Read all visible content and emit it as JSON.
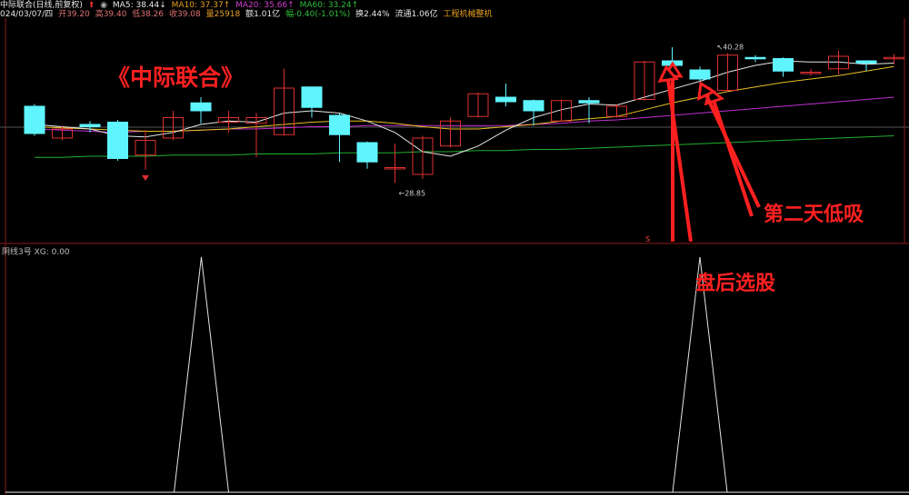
{
  "header": {
    "stock": "中际联合(日线,前复权)",
    "ma5": "MA5: 38.44↓",
    "ma10": "MA10: 37.37↑",
    "ma20": "MA20: 35.66↑",
    "ma60": "MA60: 33.24↑",
    "date": "024/03/07/四",
    "open": "开39.20",
    "high": "高39.40",
    "low": "低38.26",
    "close": "收39.08",
    "volume": "量25918",
    "amount": "额1.01亿",
    "change": "幅-0.40(-1.01%)",
    "turnover": "换2.44%",
    "float": "流通1.06亿",
    "sector": "工程机械整机"
  },
  "title": "《中际联合》",
  "annotations": {
    "low_buy": "第二天低吸",
    "after_close": "盘后选股"
  },
  "price_labels": {
    "high": "40.28",
    "low": "28.85"
  },
  "marker": "S",
  "indicator": {
    "label": "阴线3号  XG: 0.00"
  },
  "colors": {
    "up": "#e03030",
    "down": "#5ff5ff",
    "ma5": "#e6e6e6",
    "ma10": "#e8c020",
    "ma20": "#c030d0",
    "ma60": "#20b030",
    "annotation": "#ff2020"
  },
  "candles": [
    {
      "o": 35.6,
      "c": 33.2,
      "h": 35.8,
      "l": 33.0
    },
    {
      "o": 32.8,
      "c": 33.6,
      "h": 33.9,
      "l": 32.6
    },
    {
      "o": 34.0,
      "c": 33.8,
      "h": 34.3,
      "l": 33.3
    },
    {
      "o": 34.2,
      "c": 31.0,
      "h": 34.4,
      "l": 30.8
    },
    {
      "o": 31.3,
      "c": 32.6,
      "h": 33.5,
      "l": 30.0
    },
    {
      "o": 32.8,
      "c": 34.6,
      "h": 35.2,
      "l": 32.6
    },
    {
      "o": 35.9,
      "c": 35.2,
      "h": 36.4,
      "l": 34.1
    },
    {
      "o": 34.2,
      "c": 34.6,
      "h": 35.2,
      "l": 33.3
    },
    {
      "o": 34.1,
      "c": 34.6,
      "h": 35.0,
      "l": 31.1
    },
    {
      "o": 33.1,
      "c": 37.2,
      "h": 38.9,
      "l": 33.0
    },
    {
      "o": 37.3,
      "c": 35.5,
      "h": 37.3,
      "l": 34.6
    },
    {
      "o": 34.8,
      "c": 33.1,
      "h": 35.0,
      "l": 30.7
    },
    {
      "o": 32.4,
      "c": 30.7,
      "h": 32.5,
      "l": 30.1
    },
    {
      "o": 30.1,
      "c": 30.2,
      "h": 32.3,
      "l": 28.85
    },
    {
      "o": 29.6,
      "c": 32.8,
      "h": 33.0,
      "l": 29.2
    },
    {
      "o": 32.1,
      "c": 34.3,
      "h": 34.6,
      "l": 32.0
    },
    {
      "o": 34.7,
      "c": 36.7,
      "h": 36.8,
      "l": 34.6
    },
    {
      "o": 36.4,
      "c": 36.0,
      "h": 37.6,
      "l": 35.6
    },
    {
      "o": 36.1,
      "c": 35.2,
      "h": 36.2,
      "l": 33.9
    },
    {
      "o": 34.3,
      "c": 36.1,
      "h": 36.2,
      "l": 34.3
    },
    {
      "o": 36.1,
      "c": 35.9,
      "h": 36.4,
      "l": 34.1
    },
    {
      "o": 34.7,
      "c": 35.6,
      "h": 35.8,
      "l": 34.6
    },
    {
      "o": 36.2,
      "c": 39.5,
      "h": 39.6,
      "l": 36.1
    },
    {
      "o": 39.6,
      "c": 39.2,
      "h": 40.8,
      "l": 38.2
    },
    {
      "o": 38.8,
      "c": 38.0,
      "h": 39.1,
      "l": 37.8
    },
    {
      "o": 37.0,
      "c": 40.1,
      "h": 40.28,
      "l": 36.9
    },
    {
      "o": 39.9,
      "c": 39.8,
      "h": 40.1,
      "l": 39.5
    },
    {
      "o": 39.8,
      "c": 38.7,
      "h": 39.9,
      "l": 38.2
    },
    {
      "o": 38.5,
      "c": 38.6,
      "h": 38.9,
      "l": 38.3
    },
    {
      "o": 38.9,
      "c": 40.0,
      "h": 40.5,
      "l": 38.4
    },
    {
      "o": 39.6,
      "c": 39.4,
      "h": 39.6,
      "l": 38.7
    },
    {
      "o": 39.8,
      "c": 39.9,
      "h": 40.2,
      "l": 39.3
    }
  ],
  "ma5_values": [
    34.0,
    33.8,
    33.6,
    33.0,
    32.9,
    33.3,
    34.0,
    34.3,
    34.2,
    35.0,
    35.2,
    35.0,
    34.3,
    33.3,
    31.6,
    31.2,
    32.1,
    33.5,
    34.6,
    35.3,
    35.8,
    35.7,
    36.4,
    37.1,
    37.8,
    38.6,
    39.2,
    39.6,
    39.5,
    39.5,
    39.3,
    39.4
  ],
  "ma10_values": [
    33.8,
    33.7,
    33.6,
    33.5,
    33.4,
    33.4,
    33.5,
    33.6,
    33.8,
    34.0,
    34.2,
    34.3,
    34.3,
    34.1,
    33.8,
    33.6,
    33.6,
    33.8,
    34.0,
    34.3,
    34.5,
    34.7,
    35.3,
    35.9,
    36.4,
    36.9,
    37.3,
    37.7,
    38.0,
    38.3,
    38.7,
    39.1
  ],
  "ma20_values": [
    33.6,
    33.5,
    33.4,
    33.3,
    33.4,
    33.4,
    33.5,
    33.6,
    33.6,
    33.7,
    33.8,
    33.8,
    33.9,
    33.9,
    33.9,
    33.9,
    33.9,
    33.9,
    34.0,
    34.1,
    34.3,
    34.4,
    34.6,
    34.8,
    35.0,
    35.2,
    35.4,
    35.6,
    35.8,
    36.0,
    36.2,
    36.4
  ],
  "ma60_values": [
    31.1,
    31.1,
    31.2,
    31.2,
    31.2,
    31.3,
    31.3,
    31.3,
    31.4,
    31.4,
    31.4,
    31.5,
    31.5,
    31.5,
    31.6,
    31.6,
    31.7,
    31.7,
    31.8,
    31.8,
    31.9,
    32.0,
    32.1,
    32.2,
    32.3,
    32.4,
    32.5,
    32.6,
    32.7,
    32.8,
    32.9,
    33.0
  ],
  "signal_peaks": [
    7,
    24
  ]
}
